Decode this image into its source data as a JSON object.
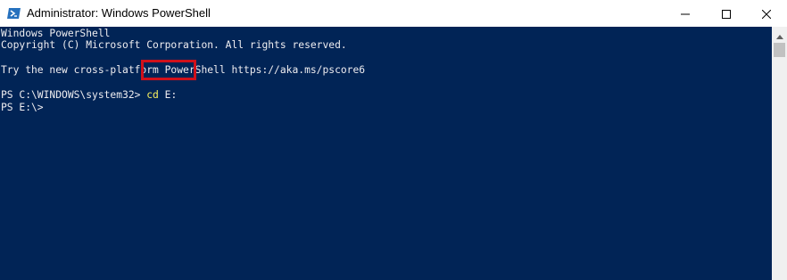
{
  "window": {
    "title": "Administrator: Windows PowerShell",
    "icon": "powershell-icon",
    "controls": {
      "minimize": "minimize-icon",
      "maximize": "maximize-icon",
      "close": "close-icon"
    }
  },
  "console": {
    "background": "#012456",
    "text_color": "#eeedf0",
    "command_color": "#fbf35f",
    "highlight_color": "#d0111b",
    "lines": [
      "Windows PowerShell",
      "Copyright (C) Microsoft Corporation. All rights reserved.",
      "",
      "Try the new cross-platform PowerShell https://aka.ms/pscore6",
      "",
      "PS C:\\WINDOWS\\system32> ",
      "PS E:\\>"
    ],
    "command": {
      "prompt": "PS C:\\WINDOWS\\system32> ",
      "word": "cd",
      "argument": " E:"
    }
  }
}
